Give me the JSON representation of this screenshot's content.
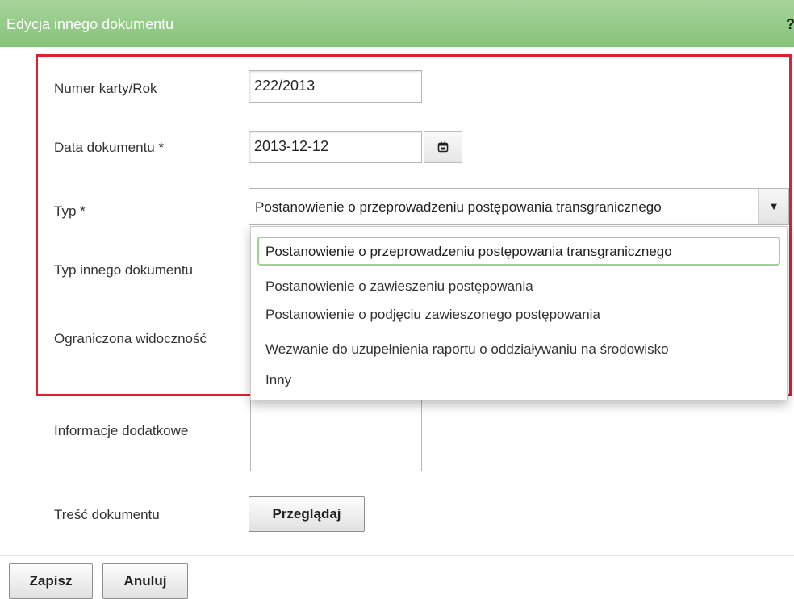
{
  "window": {
    "title": "Edycja innego dokumentu",
    "help_icon": "?"
  },
  "form": {
    "card_number": {
      "label": "Numer karty/Rok",
      "value": "222/2013"
    },
    "document_date": {
      "label": "Data dokumentu *",
      "value": "2013-12-12",
      "calendar_icon": "calendar-icon"
    },
    "type": {
      "label": "Typ *",
      "selected": "Postanowienie o przeprowadzeniu postępowania transgranicznego"
    },
    "other_type": {
      "label": "Typ innego dokumentu"
    },
    "limited_visibility": {
      "label": "Ograniczona widoczność"
    },
    "additional_info": {
      "label": "Informacje dodatkowe",
      "value": ""
    },
    "content": {
      "label": "Treść dokumentu",
      "browse_label": "Przeglądaj"
    }
  },
  "dropdown": {
    "options": [
      "Postanowienie o przeprowadzeniu postępowania transgranicznego",
      "Postanowienie o zawieszeniu postępowania",
      "Postanowienie o podjęciu zawieszonego postępowania",
      "Wezwanie do uzupełnienia raportu o oddziaływaniu na środowisko",
      "Inny"
    ]
  },
  "footer": {
    "save_label": "Zapisz",
    "cancel_label": "Anuluj"
  },
  "colors": {
    "titlebar": "#94c987",
    "highlight_border": "#e0202e",
    "selected_option_border": "#9fd194"
  }
}
